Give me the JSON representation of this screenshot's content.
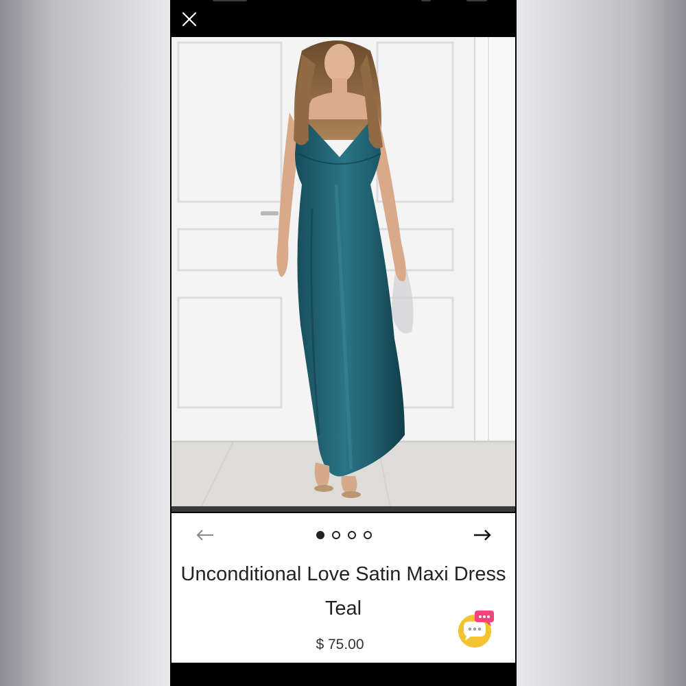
{
  "header": {
    "close_icon": "close-icon"
  },
  "product": {
    "image_alt": "teal satin maxi dress",
    "title": "Unconditional Love Satin Maxi Dress Teal",
    "price": "$ 75.00"
  },
  "carousel": {
    "prev_icon": "arrow-left-icon",
    "next_icon": "arrow-right-icon",
    "dots": [
      {
        "active": true
      },
      {
        "active": false
      },
      {
        "active": false
      },
      {
        "active": false
      }
    ]
  },
  "chat": {
    "icon": "chat-bubbles-icon"
  },
  "colors": {
    "dress": "#1f5f6e",
    "chat_yellow": "#f4c430",
    "chat_pink": "#f2457a"
  }
}
